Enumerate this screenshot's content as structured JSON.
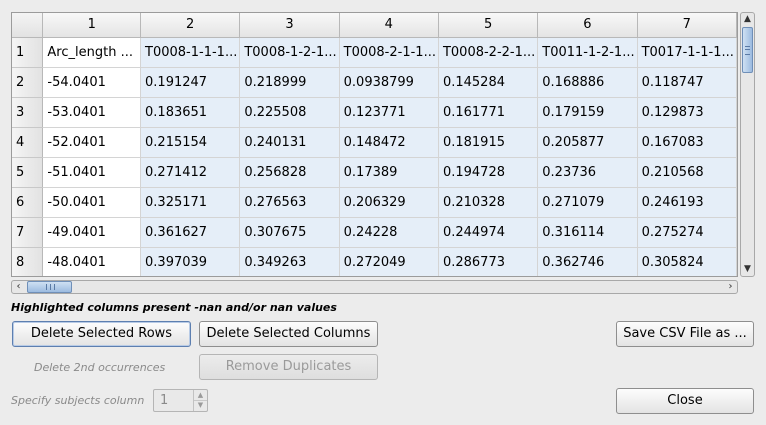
{
  "table": {
    "column_headers": [
      "1",
      "2",
      "3",
      "4",
      "5",
      "6",
      "7"
    ],
    "highlighted_columns": [
      2,
      3,
      4,
      5,
      6,
      7
    ],
    "rows": [
      {
        "row_header": "1",
        "cells": [
          "Arc_length ...",
          "T0008-1-1-1...",
          "T0008-1-2-1...",
          "T0008-2-1-1...",
          "T0008-2-2-1...",
          "T0011-1-2-1...",
          "T0017-1-1-1..."
        ]
      },
      {
        "row_header": "2",
        "cells": [
          "-54.0401",
          "0.191247",
          "0.218999",
          "0.0938799",
          "0.145284",
          "0.168886",
          "0.118747"
        ]
      },
      {
        "row_header": "3",
        "cells": [
          "-53.0401",
          "0.183651",
          "0.225508",
          "0.123771",
          "0.161771",
          "0.179159",
          "0.129873"
        ]
      },
      {
        "row_header": "4",
        "cells": [
          "-52.0401",
          "0.215154",
          "0.240131",
          "0.148472",
          "0.181915",
          "0.205877",
          "0.167083"
        ]
      },
      {
        "row_header": "5",
        "cells": [
          "-51.0401",
          "0.271412",
          "0.256828",
          "0.17389",
          "0.194728",
          "0.23736",
          "0.210568"
        ]
      },
      {
        "row_header": "6",
        "cells": [
          "-50.0401",
          "0.325171",
          "0.276563",
          "0.206329",
          "0.210328",
          "0.271079",
          "0.246193"
        ]
      },
      {
        "row_header": "7",
        "cells": [
          "-49.0401",
          "0.361627",
          "0.307675",
          "0.24228",
          "0.244974",
          "0.316114",
          "0.275274"
        ]
      },
      {
        "row_header": "8",
        "cells": [
          "-48.0401",
          "0.397039",
          "0.349263",
          "0.272049",
          "0.286773",
          "0.362746",
          "0.305824"
        ]
      }
    ]
  },
  "notice": "Highlighted columns present -nan and/or nan values",
  "buttons": {
    "delete_rows": "Delete Selected Rows",
    "delete_columns": "Delete Selected Columns",
    "save_csv": "Save CSV File as ...",
    "remove_duplicates": "Remove Duplicates",
    "close": "Close"
  },
  "labels": {
    "delete_2nd": "Delete 2nd occurrences",
    "subjects_column": "Specify subjects column"
  },
  "subjects_column_value": "1",
  "icons": {
    "scroll_up": "chevron-up-icon",
    "scroll_down": "chevron-down-icon",
    "scroll_left": "chevron-left-icon",
    "scroll_right": "chevron-right-icon"
  },
  "colors": {
    "highlight": "#e5eef8",
    "scroll_thumb": "#9cbbe0"
  }
}
